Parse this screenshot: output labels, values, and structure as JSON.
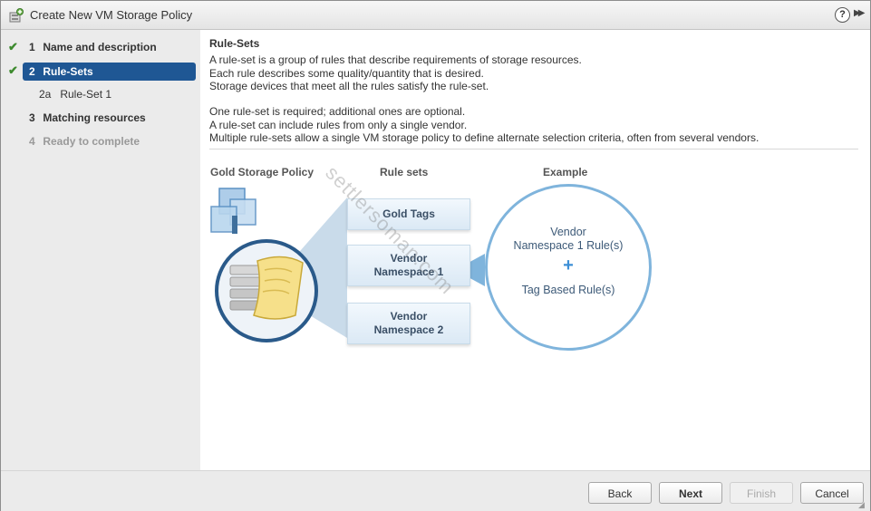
{
  "window": {
    "title": "Create New VM Storage Policy",
    "icon": "storage-policy-icon"
  },
  "header_controls": {
    "help": "?",
    "expand": "▶▶"
  },
  "steps": [
    {
      "num": "1",
      "label": "Name and description",
      "state": "done"
    },
    {
      "num": "2",
      "label": "Rule-Sets",
      "state": "active"
    },
    {
      "num": "2a",
      "label": "Rule-Set 1",
      "state": "sub"
    },
    {
      "num": "3",
      "label": "Matching resources",
      "state": "normal"
    },
    {
      "num": "4",
      "label": "Ready to complete",
      "state": "disabled"
    }
  ],
  "main": {
    "title": "Rule-Sets",
    "paragraph1": [
      "A rule-set is a group of rules that describe requirements of storage resources.",
      "Each rule describes some quality/quantity that is desired.",
      "Storage devices that meet all the rules satisfy the rule-set."
    ],
    "paragraph2": [
      "One rule-set is required; additional ones are optional.",
      "A rule-set can include rules from only a single vendor.",
      "Multiple rule-sets allow a single VM storage policy to define alternate selection criteria, often from several vendors."
    ],
    "diagram": {
      "col1": "Gold Storage Policy",
      "col2": "Rule sets",
      "col3": "Example",
      "rule_boxes": [
        "Gold Tags",
        "Vendor\nNamespace 1",
        "Vendor\nNamespace 2"
      ],
      "example_line1": "Vendor",
      "example_line2": "Namespace 1 Rule(s)",
      "example_plus": "+",
      "example_line3": "Tag Based Rule(s)"
    },
    "watermark": "settlersoman.com"
  },
  "footer": {
    "back": "Back",
    "next": "Next",
    "finish": "Finish",
    "cancel": "Cancel"
  },
  "colors": {
    "active_step": "#1f5794",
    "check": "#3d8a2e",
    "circle_border": "#7fb4dc",
    "plus": "#3d8fd6"
  }
}
